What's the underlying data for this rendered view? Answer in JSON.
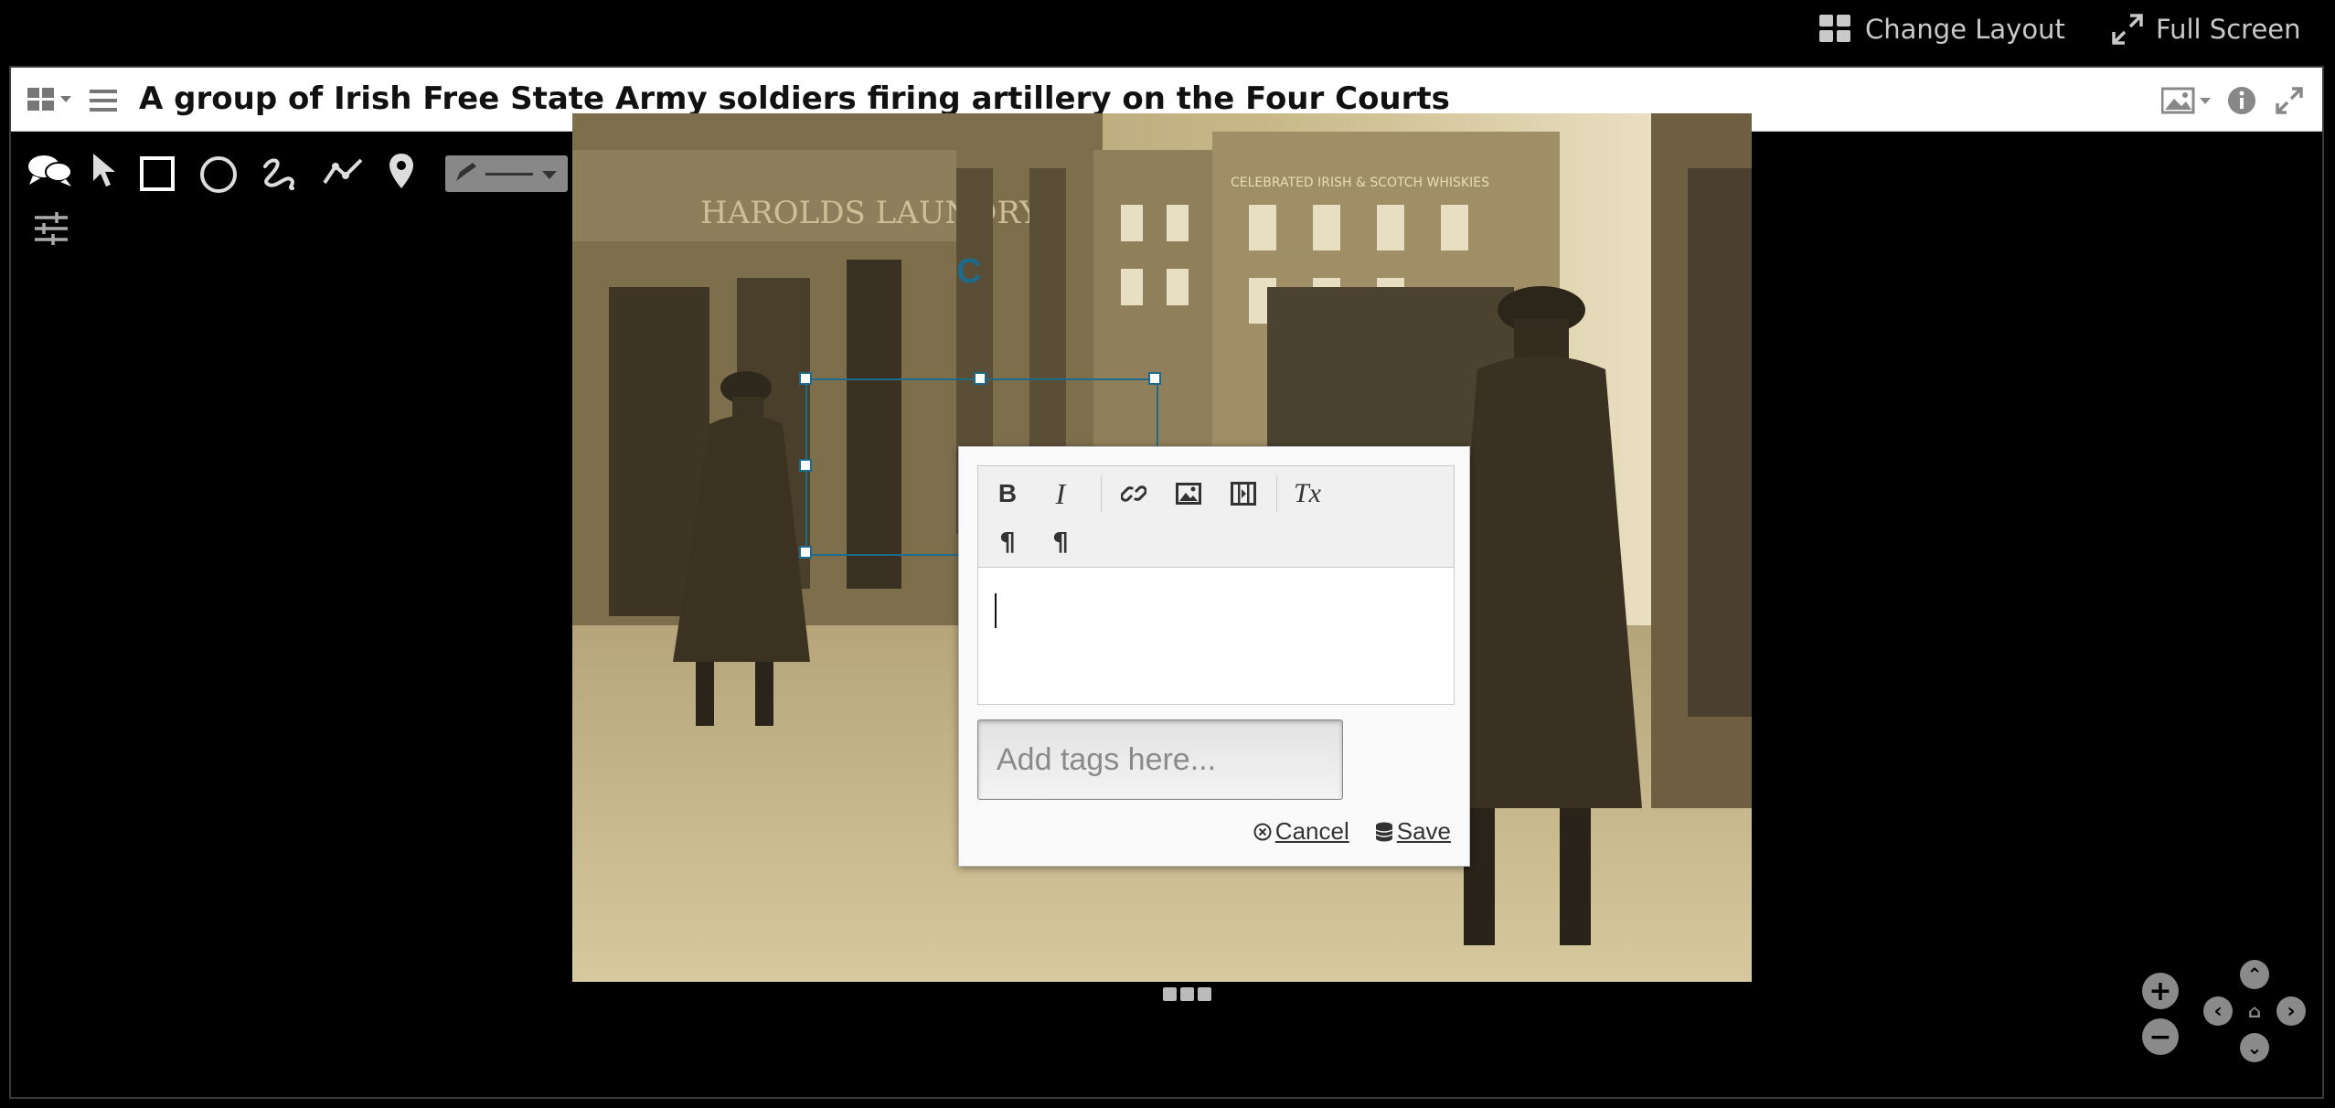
{
  "topbar": {
    "change_layout": "Change Layout",
    "full_screen": "Full Screen"
  },
  "window": {
    "title": "A group of Irish Free State Army soldiers firing artillery on the Four Courts"
  },
  "annotation_tools": {
    "icons": [
      "comments-icon",
      "pointer-icon",
      "rectangle-icon",
      "circle-icon",
      "freehand-icon",
      "polyline-icon",
      "pin-icon"
    ],
    "stroke_color": "#0f7fa3",
    "fill_color": "#d9d9d9"
  },
  "image": {
    "sign_text": "HAROLDS LAUNDRY",
    "whiskey_text": "CELEBRATED IRISH & SCOTCH WHISKIES",
    "sepia": "#b7a479"
  },
  "shape_label": "C",
  "editor": {
    "toolbar": {
      "bold": "B",
      "italic": "I",
      "clear": "Tx",
      "ltr": "¶",
      "rtl": "¶"
    },
    "tags_placeholder": "Add tags here...",
    "cancel_label": "Cancel",
    "save_label": "Save"
  },
  "colors": {
    "accent": "#1e6a8a"
  }
}
